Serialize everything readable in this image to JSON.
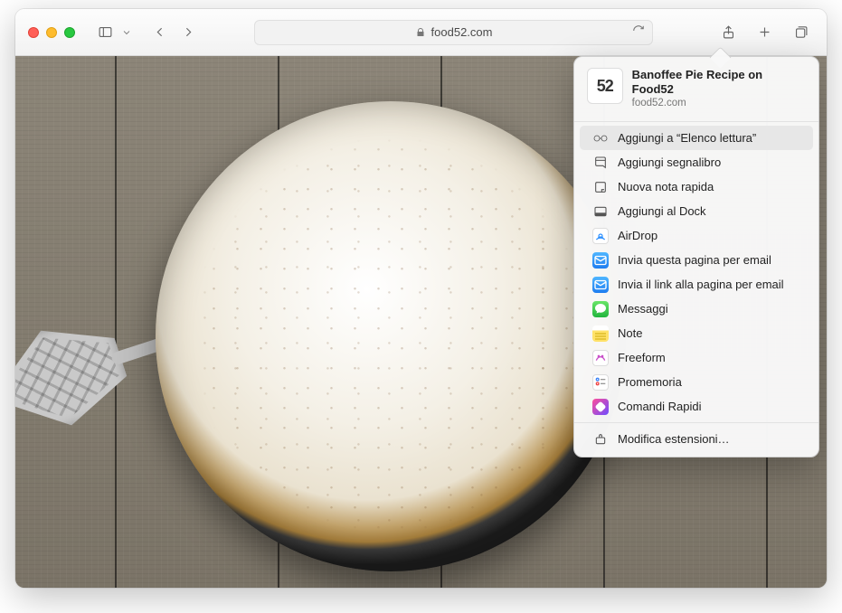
{
  "addressbar": {
    "domain": "food52.com"
  },
  "share": {
    "header": {
      "icon_text": "52",
      "title": "Banoffee Pie Recipe on Food52",
      "subtitle": "food52.com"
    },
    "items": [
      {
        "label": "Aggiungi a “Elenco lettura”"
      },
      {
        "label": "Aggiungi segnalibro"
      },
      {
        "label": "Nuova nota rapida"
      },
      {
        "label": "Aggiungi al Dock"
      },
      {
        "label": "AirDrop"
      },
      {
        "label": "Invia questa pagina per email"
      },
      {
        "label": "Invia il link alla pagina per email"
      },
      {
        "label": "Messaggi"
      },
      {
        "label": "Note"
      },
      {
        "label": "Freeform"
      },
      {
        "label": "Promemoria"
      },
      {
        "label": "Comandi Rapidi"
      }
    ],
    "footer": {
      "label": "Modifica estensioni…"
    }
  }
}
